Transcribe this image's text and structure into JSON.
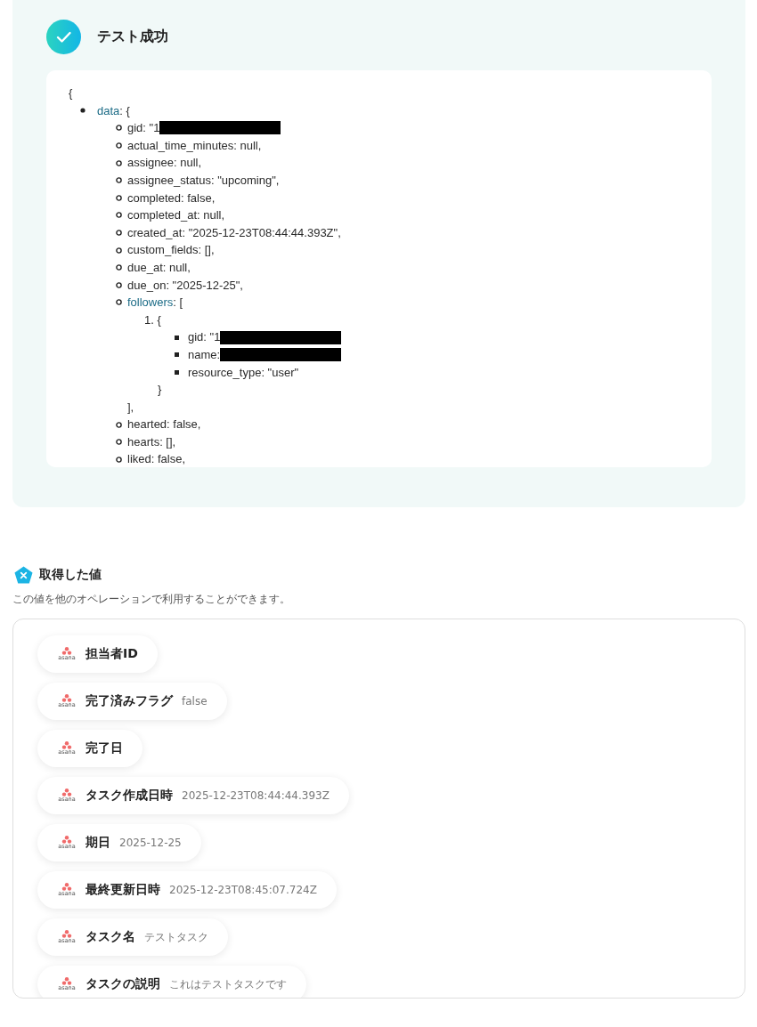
{
  "result": {
    "title": "テスト成功",
    "succeeded": true,
    "code": {
      "open": "{",
      "items": [
        {
          "key": "data",
          "rest": ": {",
          "children": [
            {
              "text": "gid: \"1",
              "redacted": true
            },
            {
              "text": "actual_time_minutes: null,"
            },
            {
              "text": "assignee: null,"
            },
            {
              "text": "assignee_status: \"upcoming\","
            },
            {
              "text": "completed: false,"
            },
            {
              "text": "completed_at: null,"
            },
            {
              "text": "created_at: \"2025-12-23T08:44:44.393Z\","
            },
            {
              "text": "custom_fields: [],"
            },
            {
              "text": "due_at: null,"
            },
            {
              "text": "due_on: \"2025-12-25\","
            },
            {
              "key": "followers",
              "rest": ": [",
              "close": "],",
              "ordered": [
                {
                  "marker": "1.",
                  "text": "{",
                  "close": "}",
                  "children": [
                    {
                      "text": "gid: \"1",
                      "redacted": true
                    },
                    {
                      "text": "name:",
                      "redacted": true
                    },
                    {
                      "text": "resource_type: \"user\""
                    }
                  ]
                }
              ]
            },
            {
              "text": "hearted: false,"
            },
            {
              "text": "hearts: [],"
            },
            {
              "text": "liked: false,"
            }
          ]
        }
      ]
    }
  },
  "values": {
    "title": "取得した値",
    "description": "この値を他のオペレーションで利用することができます。",
    "items": [
      {
        "source": "asana",
        "label": "担当者ID"
      },
      {
        "source": "asana",
        "label": "完了済みフラグ",
        "value": "false"
      },
      {
        "source": "asana",
        "label": "完了日"
      },
      {
        "source": "asana",
        "label": "タスク作成日時",
        "value": "2025-12-23T08:44:44.393Z"
      },
      {
        "source": "asana",
        "label": "期日",
        "value": "2025-12-25"
      },
      {
        "source": "asana",
        "label": "最終更新日時",
        "value": "2025-12-23T08:45:07.724Z"
      },
      {
        "source": "asana",
        "label": "タスク名",
        "value": "テストタスク"
      },
      {
        "source": "asana",
        "label": "タスクの説明",
        "value": "これはテストタスクです"
      }
    ]
  }
}
